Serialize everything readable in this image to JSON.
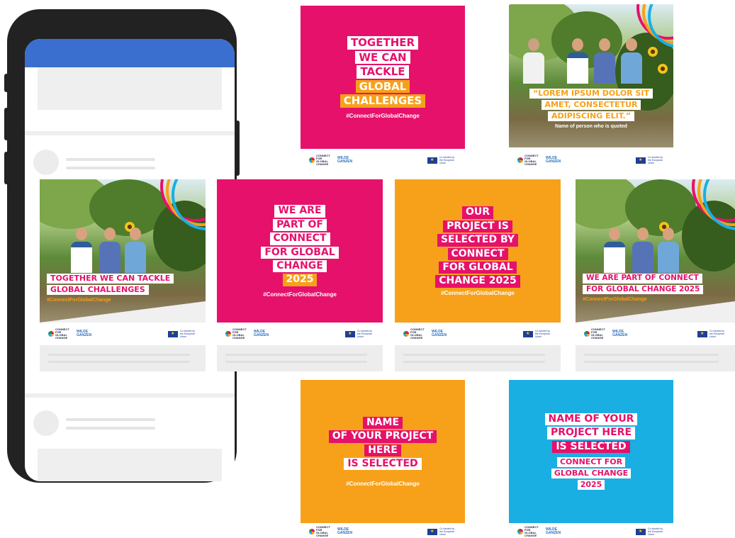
{
  "hashtag": "#ConnectForGlobalChange",
  "logos": {
    "cgc_text": "CONNECT FOR GLOBAL CHANGE",
    "wg_text": "WILDE GANZEN",
    "eu_text": "Co-funded by the European Union"
  },
  "colors": {
    "pink": "#e6116b",
    "orange": "#f7a11a",
    "blue": "#1aafe3",
    "phone_header": "#3b6fcf"
  },
  "cards": {
    "top_left": {
      "lines": [
        "TOGETHER",
        "WE CAN",
        "TACKLE",
        "GLOBAL",
        "CHALLENGES"
      ]
    },
    "top_right": {
      "quote_lines": [
        "“LOREM IPSUM DOLOR SIT",
        "AMET, CONSECTETUR",
        "ADIPISCING ELIT.”"
      ],
      "attribution": "Name of person who is quoted"
    },
    "mid_1": {
      "lines": [
        "TOGETHER WE CAN TACKLE",
        "GLOBAL CHALLENGES"
      ]
    },
    "mid_2": {
      "lines": [
        "WE ARE",
        "PART OF",
        "CONNECT",
        "FOR GLOBAL",
        "CHANGE",
        "2025"
      ]
    },
    "mid_3": {
      "lines": [
        "OUR",
        "PROJECT IS",
        "SELECTED BY",
        "CONNECT",
        "FOR GLOBAL",
        "CHANGE 2025"
      ]
    },
    "mid_4": {
      "lines": [
        "WE ARE PART OF CONNECT",
        "FOR GLOBAL CHANGE 2025"
      ]
    },
    "bottom_left": {
      "lines": [
        "NAME",
        "OF YOUR PROJECT",
        "HERE",
        "IS SELECTED"
      ]
    },
    "bottom_right": {
      "lines": [
        "NAME OF YOUR",
        "PROJECT HERE",
        "IS SELECTED"
      ],
      "sub_lines": [
        "CONNECT FOR",
        "GLOBAL CHANGE",
        "2025"
      ]
    }
  }
}
